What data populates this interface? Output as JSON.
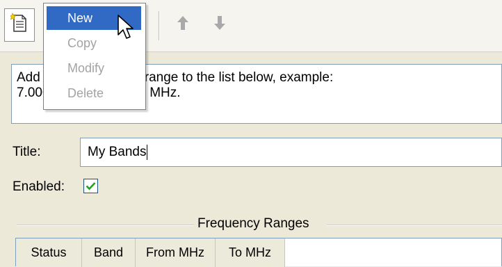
{
  "toolbar": {
    "new_icon": "new-document-icon",
    "up_icon": "arrow-up-icon",
    "down_icon": "arrow-down-icon"
  },
  "context_menu": {
    "items": [
      {
        "label": "New",
        "enabled": true,
        "selected": true
      },
      {
        "label": "Copy",
        "enabled": false
      },
      {
        "label": "Modify",
        "enabled": false
      },
      {
        "label": "Delete",
        "enabled": false
      }
    ]
  },
  "info": {
    "line1": "Add a new frequency range to the list below, example:",
    "line2": "7.000.000 - 7.100.000 MHz."
  },
  "form": {
    "title_label": "Title:",
    "title_value": "My Bands",
    "enabled_label": "Enabled:",
    "enabled_checked": true
  },
  "group": {
    "title": "Frequency Ranges"
  },
  "grid": {
    "columns": [
      "Status",
      "Band",
      "From MHz",
      "To MHz"
    ]
  },
  "colors": {
    "selection": "#316ac5",
    "window": "#ece9d8",
    "check": "#21a121"
  }
}
